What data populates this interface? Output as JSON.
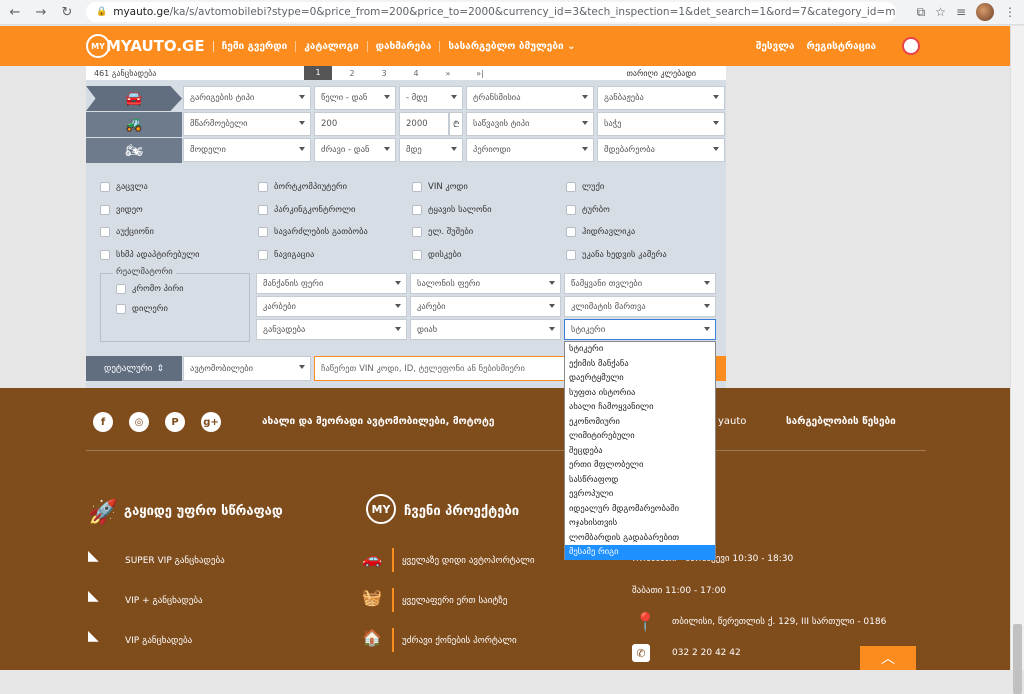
{
  "browser": {
    "url_host": "myauto.ge",
    "url_path": "/ka/s/avtomobilebi?stype=0&price_from=200&price_to=2000&currency_id=3&tech_inspection=1&det_search=1&ord=7&category_id=m0"
  },
  "header": {
    "logo": "MYAUTO.GE",
    "logo_badge": "MY",
    "nav": [
      "ჩემი გვერდი",
      "კატალოგი",
      "დახმარება",
      "სასარგებლო ბმულები ⌄"
    ],
    "login": "შესვლა",
    "register": "რეგისტრაცია"
  },
  "pagination": {
    "left": "461 განცხადება",
    "pages": [
      "1",
      "2",
      "3",
      "4",
      "»",
      "»|"
    ],
    "right": "თარიღი კლებადი"
  },
  "filters": {
    "row1": [
      "გარიგების ტიპი",
      "წელი - დან",
      "- მდე",
      "ტრანსმისია",
      "განბაჟება"
    ],
    "row2": [
      "მწარმოებელი",
      "200",
      "2000",
      "₾",
      "საწვავის ტიპი",
      "საჭე"
    ],
    "row3": [
      "მოდელი",
      "ძრავი - დან",
      "მდე",
      "პერიოდი",
      "მდებარეობა"
    ]
  },
  "checkboxes": {
    "col1": [
      "გაცვლა",
      "ვიდეო",
      "აუქციონი",
      "სხმპ ადაპტირებული"
    ],
    "col2": [
      "ბორტკომპიუტერი",
      "პარკინგკონტროლი",
      "სავარძლების გათბობა",
      "ნავიგაცია"
    ],
    "col3": [
      "VIN კოდი",
      "ტყავის სალონი",
      "ელ. შუშები",
      "დისკები"
    ],
    "col4": [
      "ლუქი",
      "ტურბო",
      "ჰიდრავლიკა",
      "უკანა ხედვის კამერა"
    ]
  },
  "realmatori": {
    "legend": "რეალმატორი",
    "options": [
      "კრომო პირი",
      "დილერი"
    ]
  },
  "extra_selects": {
    "row1": [
      "მანქანის ფერი",
      "სალონის ფერი",
      "წამყვანი თვლები"
    ],
    "row2": [
      "კარბები",
      "კარები",
      "კლიმატის მართვა"
    ],
    "row3": [
      "განვადება",
      "დიახ",
      "სტიკერი"
    ]
  },
  "bottom": {
    "detail": "დეტალური",
    "category": "ავტომობილები",
    "search_placeholder": "ჩაწერეთ VIN კოდი, ID, ტელეფონი ან ნებისმიერი"
  },
  "dropdown": {
    "items": [
      "სტიკერი",
      "ექიმის მანქანა",
      "დაერტყმული",
      "სუფთა ისტორია",
      "ახალი ჩამოყვანილი",
      "ეკონომიური",
      "ლიმიტირებული",
      "შეცდება",
      "ერთი მფლობელი",
      "სასწრაფოდ",
      "ევროპული",
      "იდეალურ მდგომარეობაში",
      "ოჯახისთვის",
      "ლომბარდის გადაბარებით",
      "მესამე რიგი"
    ],
    "selected_index": 14
  },
  "footer": {
    "social": [
      "f",
      "◎",
      "P",
      "g+"
    ],
    "headline": "ახალი და მეორადი ავტომობილები, მოტოტე",
    "headline_tail": "yauto",
    "rules": "სარგებლობის წესები",
    "col1_title": "გაყიდე უფრო სწრაფად",
    "col1_items": [
      "SUPER VIP განცხადება",
      "VIP + განცხადება",
      "VIP განცხადება"
    ],
    "col2_badge": "MY",
    "col2_title": "ჩვენი პროექტები",
    "col2_items": [
      "ყველაზე დიდი ავტოპორტალი",
      "ყველაფერი ერთ საიტზე",
      "უძრავი ქონების პორტალი"
    ],
    "hours": "ორშაბათი - პარასკევი 10:30 - 18:30",
    "saturday": "შაბათი 11:00 - 17:00",
    "address": "თბილისი, წერეთლის ქ. 129, III სართული - 0186",
    "phone": "032 2 20 42 42"
  }
}
